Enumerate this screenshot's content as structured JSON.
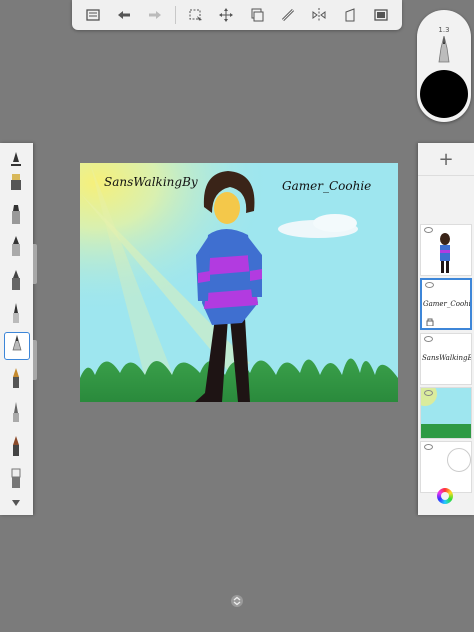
{
  "toolbar": {
    "icons": [
      "list-icon",
      "undo-icon",
      "redo-icon",
      "selection-icon",
      "move-icon",
      "copy-icon",
      "ruler-icon",
      "symmetry-icon",
      "perspective-icon",
      "frame-icon"
    ]
  },
  "brush": {
    "size": "1.3",
    "color": "#000000"
  },
  "left_tools": [
    "pencil-icon",
    "airbrush-icon",
    "marker-icon",
    "ink-pen-icon",
    "brush-icon",
    "fine-pen-icon",
    "ballpoint-pen-icon",
    "fountain-pen-icon",
    "smudge-icon",
    "paintbrush-icon",
    "eraser-icon",
    "more-tools-icon"
  ],
  "canvas": {
    "text_left": "SansWalkingBy",
    "text_right": "Gamer_Coohie"
  },
  "layers": {
    "add_label": "+",
    "items": [
      {
        "name": "character-layer",
        "text": ""
      },
      {
        "name": "signature-layer",
        "text": "Gamer_Coohie"
      },
      {
        "name": "title-layer",
        "text": "SansWalkingBy"
      },
      {
        "name": "background-layer",
        "text": ""
      },
      {
        "name": "empty-layer",
        "text": ""
      }
    ]
  },
  "colors": {
    "accent": "#3d86d8",
    "sky": "#9ee6ef",
    "grass": "#2e9a44",
    "sun": "#f3ee7a"
  }
}
